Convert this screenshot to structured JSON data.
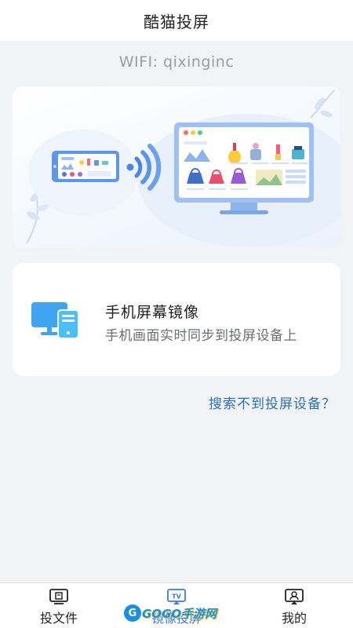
{
  "header": {
    "title": "酷猫投屏"
  },
  "wifi": {
    "text": "WIFI: qixinginc"
  },
  "banner": {
    "icon": "phone-to-tv-cast-illustration"
  },
  "mirror_card": {
    "icon": "monitor-phone-icon",
    "title": "手机屏幕镜像",
    "subtitle": "手机画面实时同步到投屏设备上"
  },
  "help_link": "搜索不到投屏设备？",
  "tabbar": {
    "tabs": [
      {
        "label": "投文件",
        "icon": "cast-file-icon",
        "active": false
      },
      {
        "label": "镜像投屏",
        "icon": "tv-icon",
        "active": true
      },
      {
        "label": "我的",
        "icon": "profile-icon",
        "active": false
      }
    ]
  },
  "watermark": {
    "mark": "G",
    "text": "GOGO手游网"
  },
  "colors": {
    "accent": "#3d7bd6",
    "link": "#2b6fb8",
    "background": "#f2f3f5"
  }
}
